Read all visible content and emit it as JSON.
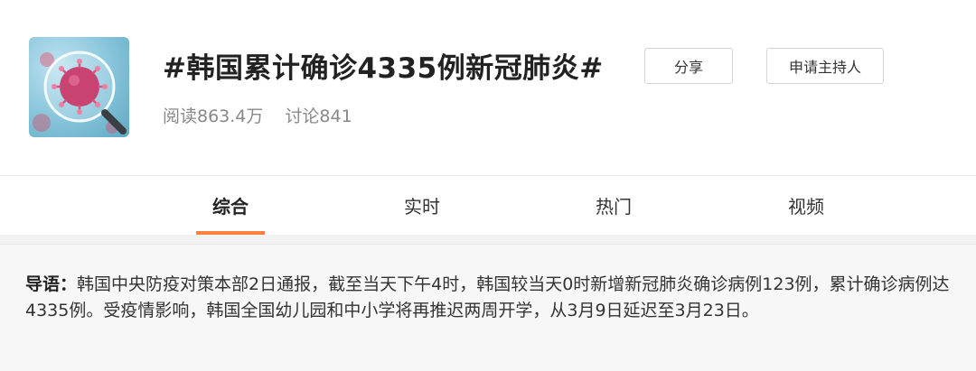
{
  "topic": {
    "title": "#韩国累计确诊4335例新冠肺炎#",
    "reads": "阅读863.4万",
    "discussions": "讨论841",
    "thumbnail_icon": "virus-magnifier-image"
  },
  "actions": {
    "share_label": "分享",
    "host_label": "申请主持人"
  },
  "tabs": [
    {
      "label": "综合",
      "active": true
    },
    {
      "label": "实时",
      "active": false
    },
    {
      "label": "热门",
      "active": false
    },
    {
      "label": "视频",
      "active": false
    }
  ],
  "guide": {
    "label": "导语：",
    "text": "韩国中央防疫对策本部2日通报，截至当天下午4时，韩国较当天0时新增新冠肺炎确诊病例123例，累计确诊病例达4335例。受疫情影响，韩国全国幼儿园和中小学将再推迟两周开学，从3月9日延迟至3月23日。"
  },
  "colors": {
    "accent": "#ff8140",
    "muted_text": "#888888",
    "guide_bg": "#f7f7f7"
  }
}
